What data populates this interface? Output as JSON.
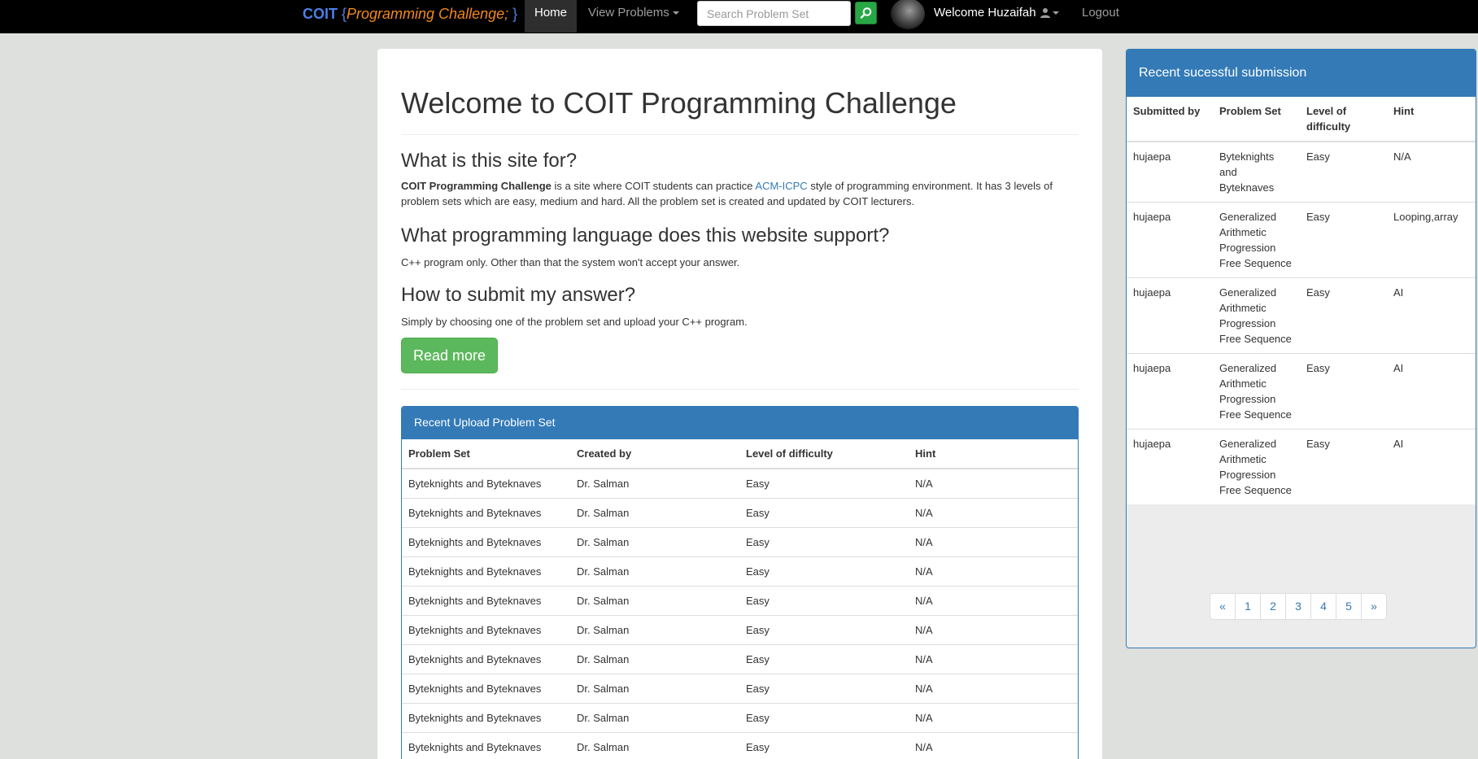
{
  "navbar": {
    "brand_coit": "COIT",
    "brand_open": " {",
    "brand_program": "Programming Challenge;",
    "brand_close": " }",
    "home": "Home",
    "view_problems": "View Problems",
    "search_placeholder": "Search Problem Set",
    "welcome": "Welcome Huzaifah",
    "logout": "Logout"
  },
  "main": {
    "title": "Welcome to COIT Programming Challenge",
    "q1": "What is this site for?",
    "p1_bold": "COIT Programming Challenge",
    "p1_a": " is a site where COIT students can practice ",
    "p1_link": "ACM-ICPC",
    "p1_b": " style of programming environment. It has 3 levels of problem sets which are easy, medium and hard. All the problem set is created and updated by COIT lecturers.",
    "q2": "What programming language does this website support?",
    "p2": "C++ program only. Other than that the system won't accept your answer.",
    "q3": "How to submit my answer?",
    "p3": "Simply by choosing one of the problem set and upload your C++ program.",
    "read_more": "Read more"
  },
  "upload": {
    "heading": "Recent Upload Problem Set",
    "headers": [
      "Problem Set",
      "Created by",
      "Level of difficulty",
      "Hint"
    ],
    "rows": [
      [
        "Byteknights and Byteknaves",
        "Dr. Salman",
        "Easy",
        "N/A"
      ],
      [
        "Byteknights and Byteknaves",
        "Dr. Salman",
        "Easy",
        "N/A"
      ],
      [
        "Byteknights and Byteknaves",
        "Dr. Salman",
        "Easy",
        "N/A"
      ],
      [
        "Byteknights and Byteknaves",
        "Dr. Salman",
        "Easy",
        "N/A"
      ],
      [
        "Byteknights and Byteknaves",
        "Dr. Salman",
        "Easy",
        "N/A"
      ],
      [
        "Byteknights and Byteknaves",
        "Dr. Salman",
        "Easy",
        "N/A"
      ],
      [
        "Byteknights and Byteknaves",
        "Dr. Salman",
        "Easy",
        "N/A"
      ],
      [
        "Byteknights and Byteknaves",
        "Dr. Salman",
        "Easy",
        "N/A"
      ],
      [
        "Byteknights and Byteknaves",
        "Dr. Salman",
        "Easy",
        "N/A"
      ],
      [
        "Byteknights and Byteknaves",
        "Dr. Salman",
        "Easy",
        "N/A"
      ]
    ]
  },
  "submissions": {
    "heading": "Recent sucessful submission",
    "headers": [
      "Submitted by",
      "Problem Set",
      "Level of difficulty",
      "Hint"
    ],
    "rows": [
      [
        "hujaepa",
        "Byteknights and Byteknaves",
        "Easy",
        "N/A"
      ],
      [
        "hujaepa",
        "Generalized Arithmetic Progression Free Sequence",
        "Easy",
        "Looping,array"
      ],
      [
        "hujaepa",
        "Generalized Arithmetic Progression Free Sequence",
        "Easy",
        "AI"
      ],
      [
        "hujaepa",
        "Generalized Arithmetic Progression Free Sequence",
        "Easy",
        "AI"
      ],
      [
        "hujaepa",
        "Generalized Arithmetic Progression Free Sequence",
        "Easy",
        "AI"
      ]
    ],
    "pagination": [
      "«",
      "1",
      "2",
      "3",
      "4",
      "5",
      "»"
    ]
  },
  "icons": {
    "search": "search-icon",
    "user": "user-icon"
  },
  "colors": {
    "primary": "#337ab7",
    "success": "#5cb85c",
    "search_button": "#28a745",
    "brand_blue": "#4d7fe6",
    "brand_orange": "#f2891a"
  }
}
